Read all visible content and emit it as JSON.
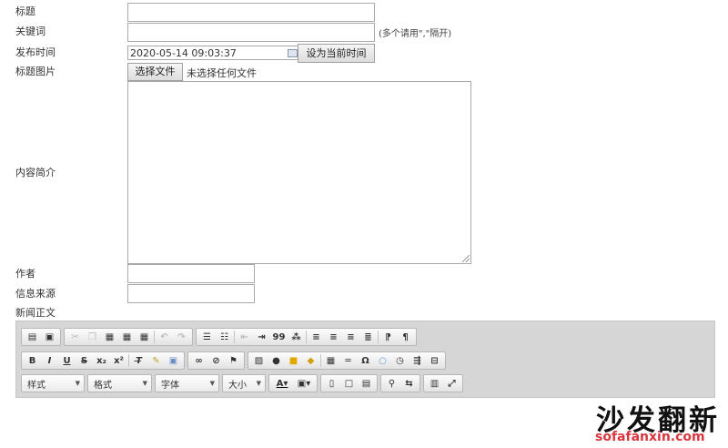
{
  "form": {
    "title_label": "标题",
    "title_value": "",
    "keywords_label": "关键词",
    "keywords_value": "",
    "keywords_hint": "(多个请用\",\"隔开)",
    "publish_label": "发布时间",
    "publish_value": "2020-05-14 09:03:37",
    "set_now_button": "设为当前时间",
    "image_label": "标题图片",
    "choose_file_button": "选择文件",
    "no_file_text": "未选择任何文件",
    "summary_label": "内容简介",
    "summary_value": "",
    "author_label": "作者",
    "author_value": "",
    "source_label": "信息来源",
    "source_value": "",
    "body_label": "新闻正文"
  },
  "toolbar": {
    "style_combo": "样式",
    "format_combo": "格式",
    "font_combo": "字体",
    "size_combo": "大小",
    "blockquote": "99",
    "omega": "Ω"
  },
  "watermark": {
    "cn": "沙发翻新",
    "en": "sofafanxin.com"
  }
}
